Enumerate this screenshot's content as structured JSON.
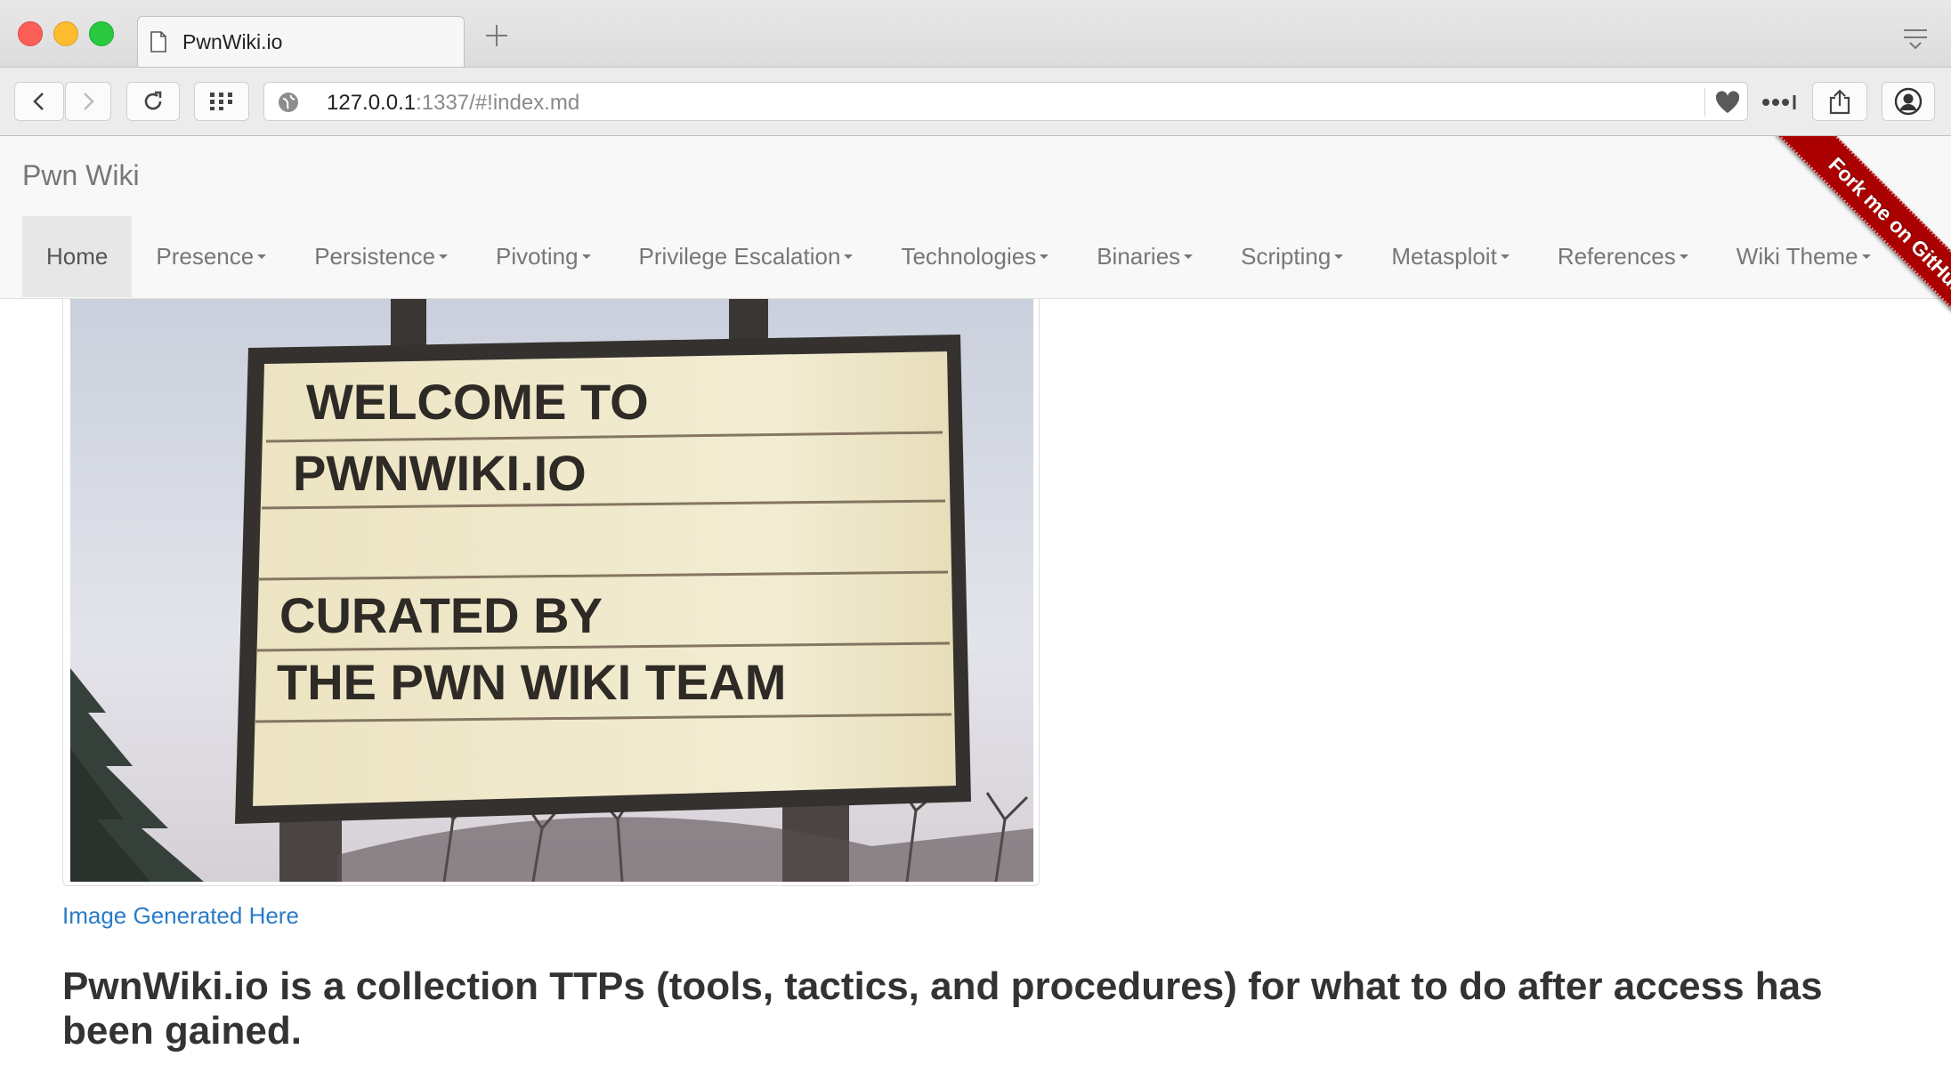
{
  "browser": {
    "tab_title": "PwnWiki.io",
    "url_host": "127.0.0.1",
    "url_rest": ":1337/#!index.md"
  },
  "navbar": {
    "brand": "Pwn Wiki",
    "items": [
      {
        "label": "Home",
        "active": true,
        "dropdown": false
      },
      {
        "label": "Presence",
        "dropdown": true
      },
      {
        "label": "Persistence",
        "dropdown": true
      },
      {
        "label": "Pivoting",
        "dropdown": true
      },
      {
        "label": "Privilege Escalation",
        "dropdown": true
      },
      {
        "label": "Technologies",
        "dropdown": true
      },
      {
        "label": "Binaries",
        "dropdown": true
      },
      {
        "label": "Scripting",
        "dropdown": true
      },
      {
        "label": "Metasploit",
        "dropdown": true
      },
      {
        "label": "References",
        "dropdown": true
      },
      {
        "label": "Wiki Theme",
        "dropdown": true
      }
    ],
    "ribbon": "Fork me on GitHub"
  },
  "content": {
    "sign_lines": [
      "WELCOME TO",
      "PWNWIKI.IO",
      "CURATED BY",
      "THE PWN WIKI TEAM"
    ],
    "caption_link": "Image Generated Here",
    "headline": "PwnWiki.io is a collection TTPs (tools, tactics, and procedures) for what to do after access has been gained."
  }
}
